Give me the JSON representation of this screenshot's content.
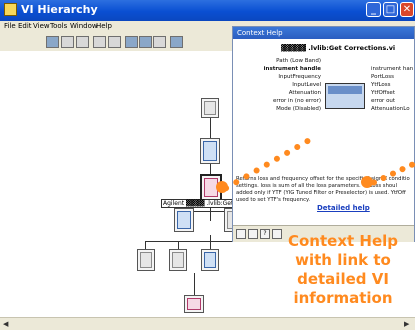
{
  "window": {
    "title": "VI Hierarchy"
  },
  "menu": [
    "File",
    "Edit",
    "View",
    "Tools",
    "Window",
    "Help"
  ],
  "node_label": "Agilent ▓▓▓▓ .lvlib:Get Corrections.vi *",
  "context_help": {
    "title": "Context Help",
    "vi_name": "▓▓▓▓▓ .lvlib:Get Corrections.vi",
    "inputs": [
      "Path (Low Band)",
      "instrument handle",
      "InputFrequency",
      "InputLevel",
      "Attenuation",
      "error in (no error)",
      "Mode (Disabled)"
    ],
    "outputs": [
      "instrument han",
      "PortLoss",
      "YtfLoss",
      "YtfOffset",
      "error out",
      "AttenuationLo"
    ],
    "description": "Returns loss and frequency offset for the specified signal conditio settings. loss is sum of all the loss parameters. YtfLoss shoul added only if YTF (YIG Tuned Filter or Preselector) is used. YtfOff used to set YTF's frequency.",
    "link": "Detailed help"
  },
  "callout": "Context Help with link to detailed VI information"
}
